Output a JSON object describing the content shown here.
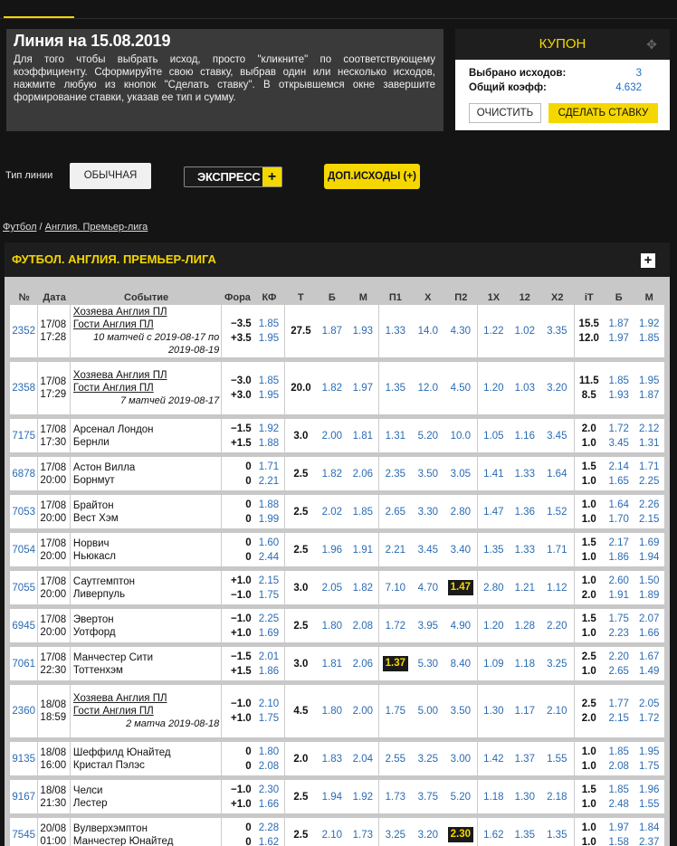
{
  "info": {
    "title": "Линия на 15.08.2019",
    "text": "Для того чтобы выбрать исход, просто \"кликните\" по соответствующему коэффициенту. Сформируйте свою ставку, выбрав один или несколько исходов, нажмите любую из кнопок \"Сделать ставку\". В открывшемся окне завершите формирование ставки, указав ее тип и сумму."
  },
  "coupon": {
    "title": "КУПОН",
    "selected_label": "Выбрано исходов:",
    "selected_value": "3",
    "total_label": "Общий коэфф:",
    "total_value": "4.632",
    "clear_label": "ОЧИСТИТЬ",
    "bet_label": "СДЕЛАТЬ СТАВКУ"
  },
  "controls": {
    "line_type_label": "Тип линии",
    "ordinary_label": "ОБЫЧНАЯ",
    "express_label": "ЭКСПРЕСС",
    "express_plus": "+",
    "extra_label": "ДОП.ИСХОДЫ (+)"
  },
  "breadcrumb": {
    "sport": "Футбол",
    "separator": " / ",
    "league": "Англия. Премьер-лига"
  },
  "section": {
    "title": "ФУТБОЛ. АНГЛИЯ. ПРЕМЬЕР-ЛИГА",
    "plus": "+"
  },
  "table": {
    "headers": [
      "№",
      "Дата",
      "Событие",
      "Фора",
      "КФ",
      "Т",
      "Б",
      "М",
      "П1",
      "Х",
      "П2",
      "1Х",
      "12",
      "Х2",
      "iТ",
      "Б",
      "М"
    ],
    "rows": [
      {
        "id": "2352",
        "date": "17/08",
        "time": "17:28",
        "team1": "Хозяева Англия ПЛ",
        "team2": "Гости Англия ПЛ",
        "note": "10 матчей с 2019-08-17 по 2019-08-19",
        "fora1": "−3.5",
        "fora2": "+3.5",
        "kf1": "1.85",
        "kf2": "1.95",
        "t": "27.5",
        "b": "1.87",
        "m": "1.93",
        "p1": "1.33",
        "x": "14.0",
        "p2": "4.30",
        "x1": "1.22",
        "x12": "1.02",
        "x2": "3.35",
        "it1": "15.5",
        "it2": "12.0",
        "ib1": "1.87",
        "ib2": "1.97",
        "im1": "1.92",
        "im2": "1.85"
      },
      {
        "id": "2358",
        "date": "17/08",
        "time": "17:29",
        "team1": "Хозяева Англия ПЛ",
        "team2": "Гости Англия ПЛ",
        "note": "7 матчей 2019-08-17",
        "fora1": "−3.0",
        "fora2": "+3.0",
        "kf1": "1.85",
        "kf2": "1.95",
        "t": "20.0",
        "b": "1.82",
        "m": "1.97",
        "p1": "1.35",
        "x": "12.0",
        "p2": "4.50",
        "x1": "1.20",
        "x12": "1.03",
        "x2": "3.20",
        "it1": "11.5",
        "it2": "8.5",
        "ib1": "1.85",
        "ib2": "1.93",
        "im1": "1.95",
        "im2": "1.87"
      },
      {
        "id": "7175",
        "date": "17/08",
        "time": "17:30",
        "team1": "Арсенал Лондон",
        "team2": "Бернли",
        "note": "",
        "fora1": "−1.5",
        "fora2": "+1.5",
        "kf1": "1.92",
        "kf2": "1.88",
        "t": "3.0",
        "b": "2.00",
        "m": "1.81",
        "p1": "1.31",
        "x": "5.20",
        "p2": "10.0",
        "x1": "1.05",
        "x12": "1.16",
        "x2": "3.45",
        "it1": "2.0",
        "it2": "1.0",
        "ib1": "1.72",
        "ib2": "3.45",
        "im1": "2.12",
        "im2": "1.31"
      },
      {
        "id": "6878",
        "date": "17/08",
        "time": "20:00",
        "team1": "Астон Вилла",
        "team2": "Борнмут",
        "note": "",
        "fora1": "0",
        "fora2": "0",
        "kf1": "1.71",
        "kf2": "2.21",
        "t": "2.5",
        "b": "1.82",
        "m": "2.06",
        "p1": "2.35",
        "x": "3.50",
        "p2": "3.05",
        "x1": "1.41",
        "x12": "1.33",
        "x2": "1.64",
        "it1": "1.5",
        "it2": "1.0",
        "ib1": "2.14",
        "ib2": "1.65",
        "im1": "1.71",
        "im2": "2.25"
      },
      {
        "id": "7053",
        "date": "17/08",
        "time": "20:00",
        "team1": "Брайтон",
        "team2": "Вест Хэм",
        "note": "",
        "fora1": "0",
        "fora2": "0",
        "kf1": "1.88",
        "kf2": "1.99",
        "t": "2.5",
        "b": "2.02",
        "m": "1.85",
        "p1": "2.65",
        "x": "3.30",
        "p2": "2.80",
        "x1": "1.47",
        "x12": "1.36",
        "x2": "1.52",
        "it1": "1.0",
        "it2": "1.0",
        "ib1": "1.64",
        "ib2": "1.70",
        "im1": "2.26",
        "im2": "2.15"
      },
      {
        "id": "7054",
        "date": "17/08",
        "time": "20:00",
        "team1": "Норвич",
        "team2": "Ньюкасл",
        "note": "",
        "fora1": "0",
        "fora2": "0",
        "kf1": "1.60",
        "kf2": "2.44",
        "t": "2.5",
        "b": "1.96",
        "m": "1.91",
        "p1": "2.21",
        "x": "3.45",
        "p2": "3.40",
        "x1": "1.35",
        "x12": "1.33",
        "x2": "1.71",
        "it1": "1.5",
        "it2": "1.0",
        "ib1": "2.17",
        "ib2": "1.86",
        "im1": "1.69",
        "im2": "1.94"
      },
      {
        "id": "7055",
        "date": "17/08",
        "time": "20:00",
        "team1": "Саутгемптон",
        "team2": "Ливерпуль",
        "note": "",
        "fora1": "+1.0",
        "fora2": "−1.0",
        "kf1": "2.15",
        "kf2": "1.75",
        "t": "3.0",
        "b": "2.05",
        "m": "1.82",
        "p1": "7.10",
        "x": "4.70",
        "p2": "1.47",
        "hl": "p2",
        "x1": "2.80",
        "x12": "1.21",
        "x2": "1.12",
        "it1": "1.0",
        "it2": "2.0",
        "ib1": "2.60",
        "ib2": "1.91",
        "im1": "1.50",
        "im2": "1.89"
      },
      {
        "id": "6945",
        "date": "17/08",
        "time": "20:00",
        "team1": "Эвертон",
        "team2": "Уотфорд",
        "note": "",
        "fora1": "−1.0",
        "fora2": "+1.0",
        "kf1": "2.25",
        "kf2": "1.69",
        "t": "2.5",
        "b": "1.80",
        "m": "2.08",
        "p1": "1.72",
        "x": "3.95",
        "p2": "4.90",
        "x1": "1.20",
        "x12": "1.28",
        "x2": "2.20",
        "it1": "1.5",
        "it2": "1.0",
        "ib1": "1.75",
        "ib2": "2.23",
        "im1": "2.07",
        "im2": "1.66"
      },
      {
        "id": "7061",
        "date": "17/08",
        "time": "22:30",
        "team1": "Манчестер Сити",
        "team2": "Тоттенхэм",
        "note": "",
        "fora1": "−1.5",
        "fora2": "+1.5",
        "kf1": "2.01",
        "kf2": "1.86",
        "t": "3.0",
        "b": "1.81",
        "m": "2.06",
        "p1": "1.37",
        "hl": "p1",
        "x": "5.30",
        "p2": "8.40",
        "x1": "1.09",
        "x12": "1.18",
        "x2": "3.25",
        "it1": "2.5",
        "it2": "1.0",
        "ib1": "2.20",
        "ib2": "2.65",
        "im1": "1.67",
        "im2": "1.49"
      },
      {
        "id": "2360",
        "date": "18/08",
        "time": "18:59",
        "team1": "Хозяева Англия ПЛ",
        "team2": "Гости Англия ПЛ",
        "note": "2 матча 2019-08-18",
        "fora1": "−1.0",
        "fora2": "+1.0",
        "kf1": "2.10",
        "kf2": "1.75",
        "t": "4.5",
        "b": "1.80",
        "m": "2.00",
        "p1": "1.75",
        "x": "5.00",
        "p2": "3.50",
        "x1": "1.30",
        "x12": "1.17",
        "x2": "2.10",
        "it1": "2.5",
        "it2": "2.0",
        "ib1": "1.77",
        "ib2": "2.15",
        "im1": "2.05",
        "im2": "1.72"
      },
      {
        "id": "9135",
        "date": "18/08",
        "time": "16:00",
        "team1": "Шеффилд Юнайтед",
        "team2": "Кристал Пэлэс",
        "note": "",
        "fora1": "0",
        "fora2": "0",
        "kf1": "1.80",
        "kf2": "2.08",
        "t": "2.0",
        "b": "1.83",
        "m": "2.04",
        "p1": "2.55",
        "x": "3.25",
        "p2": "3.00",
        "x1": "1.42",
        "x12": "1.37",
        "x2": "1.55",
        "it1": "1.0",
        "it2": "1.0",
        "ib1": "1.85",
        "ib2": "2.08",
        "im1": "1.95",
        "im2": "1.75"
      },
      {
        "id": "9167",
        "date": "18/08",
        "time": "21:30",
        "team1": "Челси",
        "team2": "Лестер",
        "note": "",
        "fora1": "−1.0",
        "fora2": "+1.0",
        "kf1": "2.30",
        "kf2": "1.66",
        "t": "2.5",
        "b": "1.94",
        "m": "1.92",
        "p1": "1.73",
        "x": "3.75",
        "p2": "5.20",
        "x1": "1.18",
        "x12": "1.30",
        "x2": "2.18",
        "it1": "1.5",
        "it2": "1.0",
        "ib1": "1.85",
        "ib2": "2.48",
        "im1": "1.96",
        "im2": "1.55"
      },
      {
        "id": "7545",
        "date": "20/08",
        "time": "01:00",
        "team1": "Вулверхэмптон",
        "team2": "Манчестер Юнайтед",
        "note": "",
        "fora1": "0",
        "fora2": "0",
        "kf1": "2.28",
        "kf2": "1.62",
        "t": "2.5",
        "b": "2.10",
        "m": "1.73",
        "p1": "3.25",
        "x": "3.20",
        "p2": "2.30",
        "hl": "p2",
        "x1": "1.62",
        "x12": "1.35",
        "x2": "1.35",
        "it1": "1.0",
        "it2": "1.0",
        "ib1": "1.97",
        "ib2": "1.58",
        "im1": "1.84",
        "im2": "2.37"
      }
    ]
  },
  "colors": {
    "accent": "#f5d700",
    "link": "#2a6bb3",
    "panel": "#3a3a3a",
    "background": "#141414"
  },
  "icons": {
    "coupon_settings": "gear-icon",
    "expand": "plus-icon"
  }
}
